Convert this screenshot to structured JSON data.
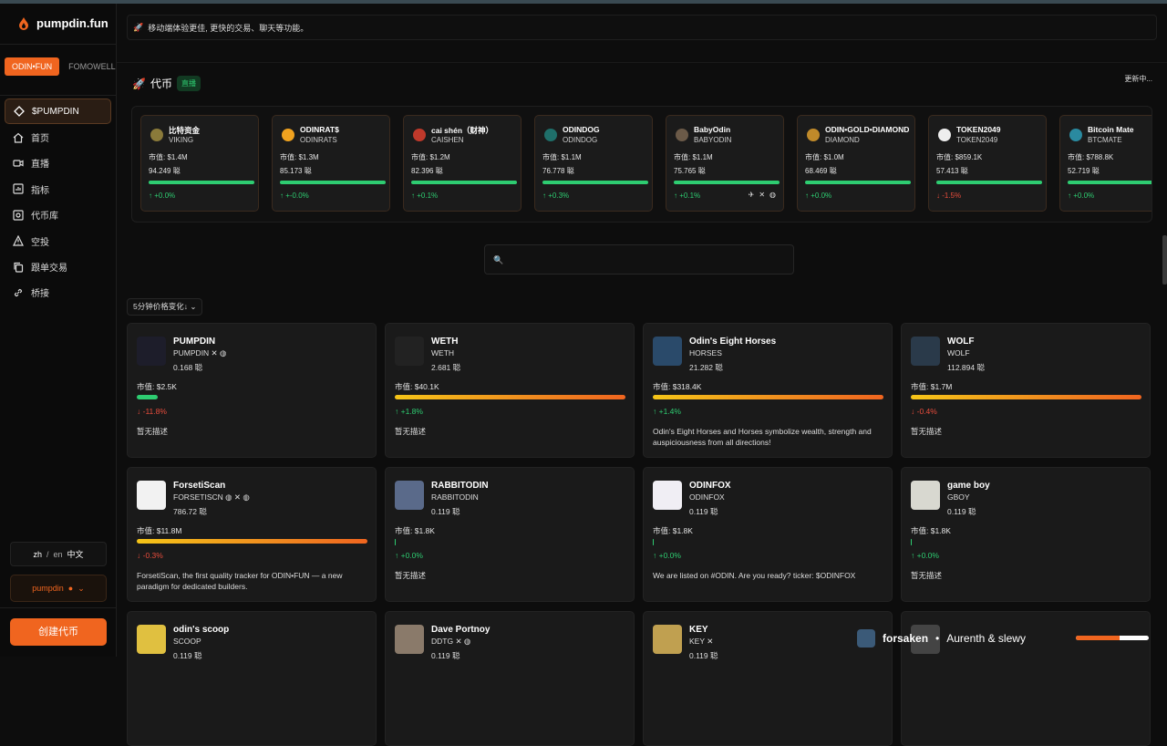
{
  "sidebar": {
    "brand": "pumpdin.fun",
    "tabs": [
      "ODIN•FUN",
      "FOMOWELL"
    ],
    "items": [
      {
        "label": "$PUMPDIN",
        "icon": "diamond-icon"
      },
      {
        "label": "首页",
        "icon": "home-icon"
      },
      {
        "label": "直播",
        "icon": "video-icon"
      },
      {
        "label": "指标",
        "icon": "chart-icon"
      },
      {
        "label": "代币库",
        "icon": "vault-icon"
      },
      {
        "label": "空投",
        "icon": "airdrop-icon"
      },
      {
        "label": "跟单交易",
        "icon": "copy-icon"
      },
      {
        "label": "桥接",
        "icon": "link-icon"
      }
    ],
    "lang": {
      "current": "zh",
      "sep": "/",
      "alt": "en",
      "alt_label": "中文"
    },
    "user": "pumpdin",
    "create_label": "创建代币"
  },
  "banner": "移动端体验更佳, 更快的交易、聊天等功能。",
  "section": {
    "title": "代币",
    "badge": "直播",
    "updating": "更新中..."
  },
  "mini_tokens": [
    {
      "name": "比特资金",
      "ticker": "VIKING",
      "mc": "市值: $1.4M",
      "hold": "94.249 聪",
      "change": "↑ +0.0%",
      "dir": "up",
      "color": "#8a7a3a"
    },
    {
      "name": "ODINRAT$",
      "ticker": "ODINRATS",
      "mc": "市值: $1.3M",
      "hold": "85.173 聪",
      "change": "↑ +-0.0%",
      "dir": "up",
      "color": "#f0a21f"
    },
    {
      "name": "cai shén（财神）",
      "ticker": "CAISHEN",
      "mc": "市值: $1.2M",
      "hold": "82.396 聪",
      "change": "↑ +0.1%",
      "dir": "up",
      "color": "#c0392b"
    },
    {
      "name": "ODINDOG",
      "ticker": "ODINDOG",
      "mc": "市值: $1.1M",
      "hold": "76.778 聪",
      "change": "↑ +0.3%",
      "dir": "up",
      "color": "#1f6f6a"
    },
    {
      "name": "BabyOdin",
      "ticker": "BABYODIN",
      "mc": "市值: $1.1M",
      "hold": "75.765 聪",
      "change": "↑ +0.1%",
      "dir": "up",
      "color": "#6b5a48",
      "socials": true
    },
    {
      "name": "ODIN•GOLD•DIAMOND",
      "ticker": "DIAMOND",
      "mc": "市值: $1.0M",
      "hold": "68.469 聪",
      "change": "↑ +0.0%",
      "dir": "up",
      "color": "#c08a2a"
    },
    {
      "name": "TOKEN2049",
      "ticker": "TOKEN2049",
      "mc": "市值: $859.1K",
      "hold": "57.413 聪",
      "change": "↓ -1.5%",
      "dir": "down",
      "color": "#eeeeee"
    },
    {
      "name": "Bitcoin Mate",
      "ticker": "BTCMATE",
      "mc": "市值: $788.8K",
      "hold": "52.719 聪",
      "change": "↑ +0.0%",
      "dir": "up",
      "color": "#2a8aa0"
    }
  ],
  "search": {
    "placeholder": ""
  },
  "sort_label": "5分钟价格变化↓",
  "cards": [
    {
      "name": "PUMPDIN",
      "ticker": "PUMPDIN ✕ ◍",
      "hold": "0.168 聪",
      "mc": "市值: $2.5K",
      "bar": 0.09,
      "bar_style": "green",
      "change": "↓ -11.8%",
      "dir": "down",
      "desc": "暂无描述",
      "color": "#1d1d2a"
    },
    {
      "name": "WETH",
      "ticker": "WETH",
      "hold": "2.681 聪",
      "mc": "市值: $40.1K",
      "bar": 1.0,
      "bar_style": "grad",
      "change": "↑ +1.8%",
      "dir": "up",
      "desc": "暂无描述",
      "color": "#222222"
    },
    {
      "name": "Odin's Eight Horses",
      "ticker": "HORSES",
      "hold": "21.282 聪",
      "mc": "市值: $318.4K",
      "bar": 1.0,
      "bar_style": "grad",
      "change": "↑ +1.4%",
      "dir": "up",
      "desc": "Odin's Eight Horses and Horses symbolize wealth, strength and auspiciousness from all directions!",
      "color": "#2a4a6a"
    },
    {
      "name": "WOLF",
      "ticker": "WOLF",
      "hold": "112.894 聪",
      "mc": "市值: $1.7M",
      "bar": 1.0,
      "bar_style": "grad",
      "change": "↓ -0.4%",
      "dir": "down",
      "desc": "暂无描述",
      "color": "#2a3a4a"
    },
    {
      "name": "ForsetiScan",
      "ticker": "FORSETISCN ◍ ✕ ◍",
      "hold": "786.72 聪",
      "mc": "市值: $11.8M",
      "bar": 1.0,
      "bar_style": "grad",
      "change": "↓ -0.3%",
      "dir": "down",
      "desc": "ForsetiScan, the first quality tracker for ODIN•FUN — a new paradigm for dedicated builders.",
      "color": "#f2f2f2"
    },
    {
      "name": "RABBITODIN",
      "ticker": "RABBITODIN",
      "hold": "0.119 聪",
      "mc": "市值: $1.8K",
      "bar": 0.0,
      "bar_style": "tiny",
      "change": "↑ +0.0%",
      "dir": "up",
      "desc": "暂无描述",
      "color": "#5a6a8a"
    },
    {
      "name": "ODINFOX",
      "ticker": "ODINFOX",
      "hold": "0.119 聪",
      "mc": "市值: $1.8K",
      "bar": 0.0,
      "bar_style": "tiny",
      "change": "↑ +0.0%",
      "dir": "up",
      "desc": "We are listed on #ODIN. Are you ready? ticker: $ODINFOX",
      "color": "#f0eef4"
    },
    {
      "name": "game boy",
      "ticker": "GBOY",
      "hold": "0.119 聪",
      "mc": "市值: $1.8K",
      "bar": 0.0,
      "bar_style": "tiny",
      "change": "↑ +0.0%",
      "dir": "up",
      "desc": "暂无描述",
      "color": "#d8d8d0"
    },
    {
      "name": "odin's scoop",
      "ticker": "SCOOP",
      "hold": "0.119 聪",
      "mc": "",
      "bar": 0.0,
      "bar_style": "none",
      "change": "",
      "dir": "up",
      "desc": "",
      "color": "#e0c040"
    },
    {
      "name": "Dave Portnoy",
      "ticker": "DDTG ✕ ◍",
      "hold": "0.119 聪",
      "mc": "",
      "bar": 0.0,
      "bar_style": "none",
      "change": "",
      "dir": "up",
      "desc": "",
      "color": "#8a7a6a"
    },
    {
      "name": "KEY",
      "ticker": "KEY ✕",
      "hold": "0.119 聪",
      "mc": "",
      "bar": 0.0,
      "bar_style": "none",
      "change": "",
      "dir": "up",
      "desc": "",
      "color": "#c0a050"
    },
    {
      "name": "",
      "ticker": "",
      "hold": "",
      "mc": "",
      "bar": 0.0,
      "bar_style": "none",
      "change": "",
      "dir": "up",
      "desc": "",
      "color": "#444444"
    }
  ],
  "player": {
    "title": "forsaken",
    "sep": "•",
    "artist": "Aurenth & slewy",
    "progress": 0.6
  }
}
